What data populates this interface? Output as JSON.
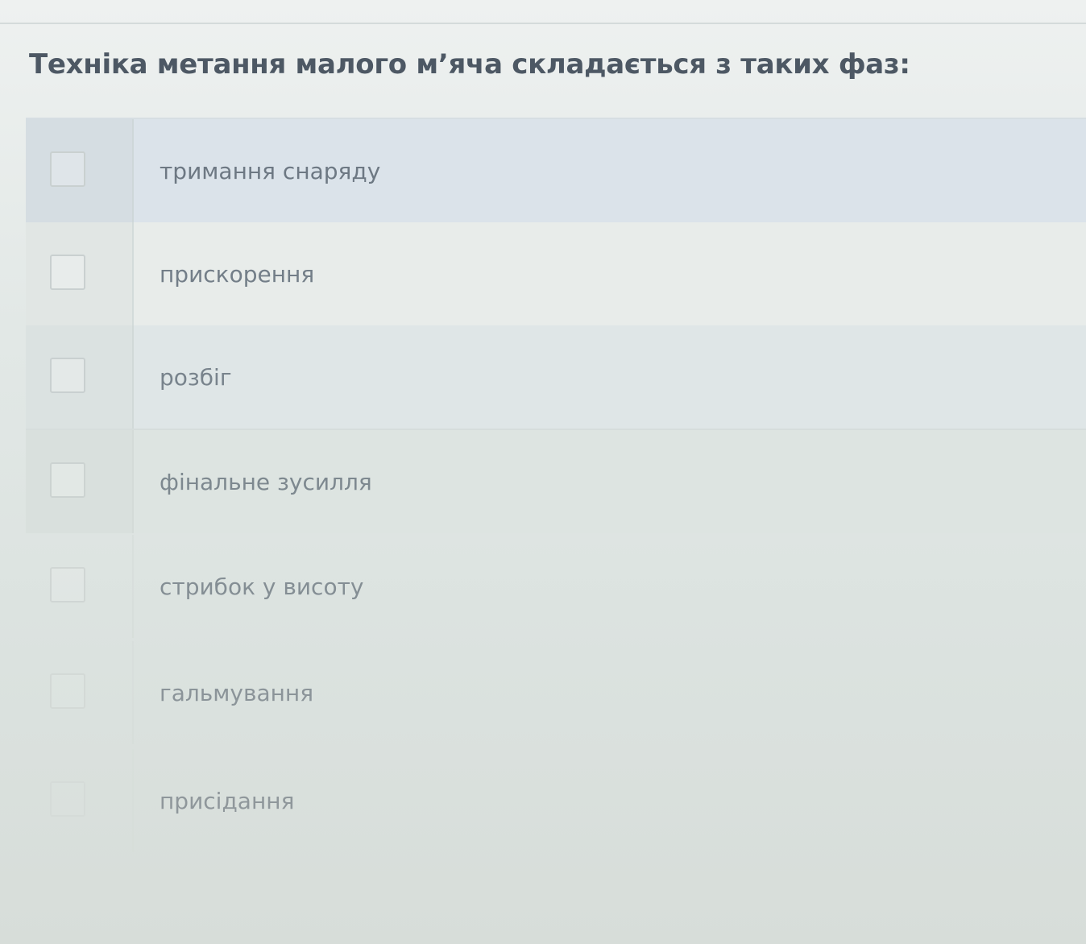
{
  "question": {
    "text": "Техніка метання малого м’яча складається з таких фаз:"
  },
  "options": [
    {
      "label": "тримання снаряду",
      "checked": false
    },
    {
      "label": "прискорення",
      "checked": false
    },
    {
      "label": "розбіг",
      "checked": false
    },
    {
      "label": "фінальне зусилля",
      "checked": false
    },
    {
      "label": "стрибок у висоту",
      "checked": false
    },
    {
      "label": "гальмування",
      "checked": false
    },
    {
      "label": "присідання",
      "checked": false
    }
  ]
}
